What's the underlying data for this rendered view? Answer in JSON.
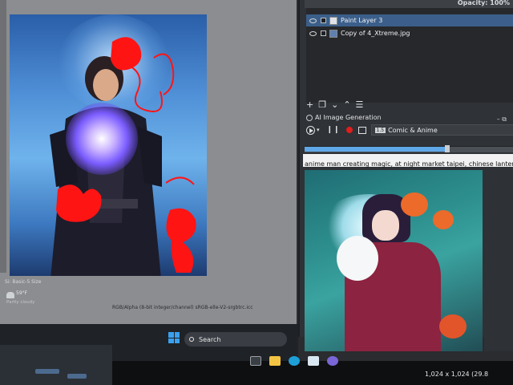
{
  "layers": {
    "opacity_label": "Opacity:  100%",
    "items": [
      {
        "name": "Paint Layer 3",
        "selected": true
      },
      {
        "name": "Copy of 4_Xtreme.jpg",
        "selected": false
      }
    ]
  },
  "layer_toolbar": {
    "add_icon": "plus-icon",
    "duplicate_icon": "duplicate-icon",
    "move_down_icon": "chevron-down-icon",
    "move_up_icon": "chevron-up-icon",
    "menu_icon": "menu-icon"
  },
  "ai_panel": {
    "title": "AI Image Generation",
    "style_badge": "1.5",
    "style_value": "Comic & Anime",
    "progress": 0.68,
    "prompt": "anime man creating magic, at night market taipei, chinese lantern"
  },
  "canvas": {
    "color_info": "RGB/Alpha (8-bit integer/channel)  sRGB-elle-V2-srgbtrc.icc",
    "size_label": "Si: Basic-5 Size"
  },
  "weather": {
    "temperature": "59°F",
    "condition": "Partly cloudy"
  },
  "image_dimensions": "1,024 x 1,024 (29.8",
  "taskbar": {
    "search_label": "Search"
  },
  "colors": {
    "panel_bg": "#2f3236",
    "selected_layer": "#3b5f8a",
    "record": "#e11d1d",
    "progress_fill": "#5fa8e8",
    "accent_scribble": "#ff1414"
  }
}
